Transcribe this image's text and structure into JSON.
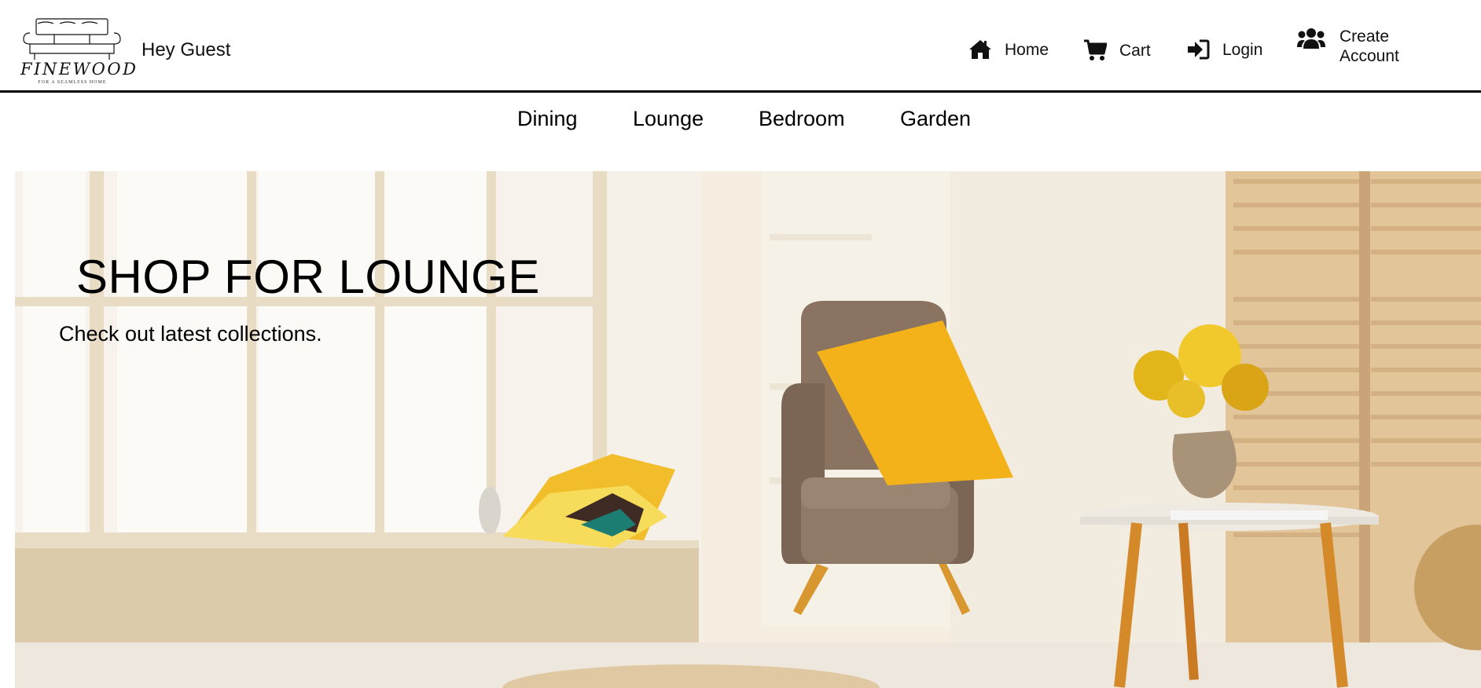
{
  "brand": {
    "name": "FINEWOOD",
    "tagline": "FOR A SEAMLESS HOME"
  },
  "header": {
    "greeting": "Hey Guest"
  },
  "nav": {
    "home_label": "Home",
    "cart_label": "Cart",
    "login_label": "Login",
    "create_account_label": "Create Account"
  },
  "categories": [
    "Dining",
    "Lounge",
    "Bedroom",
    "Garden"
  ],
  "hero": {
    "title": "SHOP FOR LOUNGE",
    "subtitle": "Check out latest collections."
  },
  "icons": {
    "home": "home-icon",
    "cart": "cart-icon",
    "login": "sign-in-icon",
    "create_account": "users-icon"
  },
  "colors": {
    "accent_yellow": "#f3b21a",
    "chair_brown": "#8a7461",
    "wood": "#d9a35a"
  }
}
